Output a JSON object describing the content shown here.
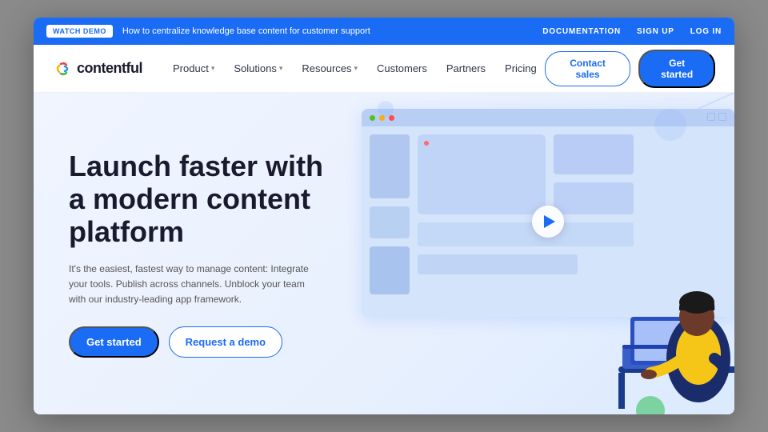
{
  "topbar": {
    "watch_demo_label": "WATCH DEMO",
    "message": "How to centralize knowledge base content for customer support",
    "links": [
      {
        "label": "DOCUMENTATION",
        "name": "documentation-link"
      },
      {
        "label": "SIGN UP",
        "name": "signup-link"
      },
      {
        "label": "LOG IN",
        "name": "login-link"
      }
    ]
  },
  "navbar": {
    "logo_text": "contentful",
    "nav_items": [
      {
        "label": "Product",
        "has_dropdown": true,
        "name": "product-nav"
      },
      {
        "label": "Solutions",
        "has_dropdown": true,
        "name": "solutions-nav"
      },
      {
        "label": "Resources",
        "has_dropdown": true,
        "name": "resources-nav"
      },
      {
        "label": "Customers",
        "has_dropdown": false,
        "name": "customers-nav"
      },
      {
        "label": "Partners",
        "has_dropdown": false,
        "name": "partners-nav"
      },
      {
        "label": "Pricing",
        "has_dropdown": false,
        "name": "pricing-nav"
      }
    ],
    "contact_sales_label": "Contact sales",
    "get_started_label": "Get started"
  },
  "hero": {
    "title": "Launch faster with a modern content platform",
    "subtitle": "It's the easiest, fastest way to manage content: Integrate your tools. Publish across channels. Unblock your team with our industry-leading app framework.",
    "cta_primary": "Get started",
    "cta_secondary": "Request a demo"
  },
  "colors": {
    "primary_blue": "#1a6cf5",
    "dark_text": "#1a1a2e",
    "hero_bg": "#eef3ff"
  }
}
